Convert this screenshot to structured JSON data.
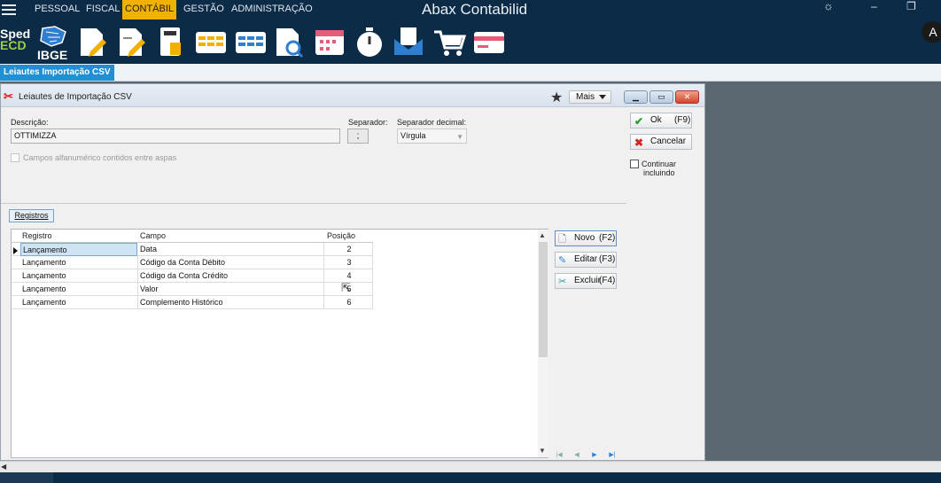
{
  "menu": {
    "items": [
      "PESSOAL",
      "FISCAL",
      "CONTÁBIL",
      "GESTÃO",
      "ADMINISTRAÇÃO"
    ],
    "active": "CONTÁBIL"
  },
  "app_title": "Abax Contabilid",
  "toolbar": {
    "sped_line1": "Sped",
    "sped_line2": "ECD",
    "ibge": "IBGE",
    "icons": [
      "document-edit-icon",
      "document-edit-icon",
      "calculator-icon",
      "table-yellow-icon",
      "table-blue-icon",
      "document-search-icon",
      "calendar-icon",
      "stopwatch-icon",
      "mail-icon",
      "cart-icon",
      "card-icon"
    ]
  },
  "tab": {
    "label": "Leiautes Importação CSV"
  },
  "dialog": {
    "title": "Leiautes de Importação CSV",
    "mais_label": "Mais",
    "fields": {
      "descricao_label": "Descrição:",
      "descricao_value": "OTTIMIZZA",
      "separador_label": "Separador:",
      "separador_value": ";",
      "separador_decimal_label": "Separador decimal:",
      "separador_decimal_value": "Vírgula",
      "aspas_label": "Campos alfanumérico contidos entre aspas",
      "aspas_checked": false
    },
    "buttons": {
      "ok": "Ok",
      "ok_key": "(F9)",
      "cancelar": "Cancelar",
      "continuar_line1": "Continuar",
      "continuar_line2": "incluindo",
      "continuar_checked": false
    },
    "registros_tab": "Registros",
    "grid": {
      "columns": [
        "Registro",
        "Campo",
        "Posição"
      ],
      "rows": [
        [
          "Lançamento",
          "Data",
          "2"
        ],
        [
          "Lançamento",
          "Código da Conta Débito",
          "3"
        ],
        [
          "Lançamento",
          "Código da Conta Crédito",
          "4"
        ],
        [
          "Lançamento",
          "Valor",
          "5"
        ],
        [
          "Lançamento",
          "Complemento Histórico",
          "6"
        ]
      ]
    },
    "grid_buttons": {
      "novo": "Novo",
      "novo_key": "(F2)",
      "editar": "Editar",
      "editar_key": "(F3)",
      "excluir": "Excluir",
      "excluir_key": "(F4)"
    }
  },
  "colors": {
    "menubar": "#0b2b47",
    "active_menu": "#f2b000",
    "tab_active": "#1f8fd6",
    "workspace": "#5a6670"
  }
}
